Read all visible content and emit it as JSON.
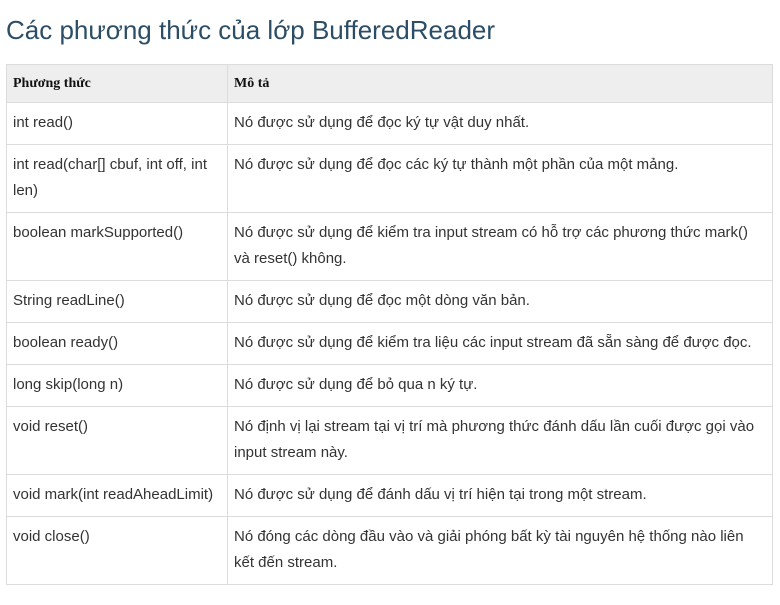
{
  "page": {
    "title": "Các phương thức của lớp BufferedReader"
  },
  "table": {
    "headers": [
      "Phương thức",
      "Mô tả"
    ],
    "rows": [
      {
        "method": "int read()",
        "description": "Nó được sử dụng để đọc ký tự vật duy nhất."
      },
      {
        "method": "int read(char[] cbuf, int off, int len)",
        "description": "Nó được sử dụng để đọc các ký tự thành một phần của một mảng."
      },
      {
        "method": "boolean markSupported()",
        "description": "Nó được sử dụng để kiểm tra input stream có hỗ trợ các phương thức mark() và reset() không."
      },
      {
        "method": "String readLine()",
        "description": "Nó được sử dụng để đọc một dòng văn bản."
      },
      {
        "method": "boolean ready()",
        "description": "Nó được sử dụng để kiểm tra liệu các input stream đã sẵn sàng để được đọc."
      },
      {
        "method": "long skip(long n)",
        "description": "Nó được sử dụng để bỏ qua n ký tự."
      },
      {
        "method": "void reset()",
        "description": "Nó định vị lại stream tại vị trí mà phương thức đánh dấu lần cuối được gọi vào input stream này."
      },
      {
        "method": "void mark(int readAheadLimit)",
        "description": "Nó được sử dụng để đánh dấu vị trí hiện tại trong một stream."
      },
      {
        "method": "void close()",
        "description": "Nó đóng các dòng đầu vào và giải phóng bất kỳ tài nguyên hệ thống nào liên kết đến stream."
      }
    ]
  }
}
